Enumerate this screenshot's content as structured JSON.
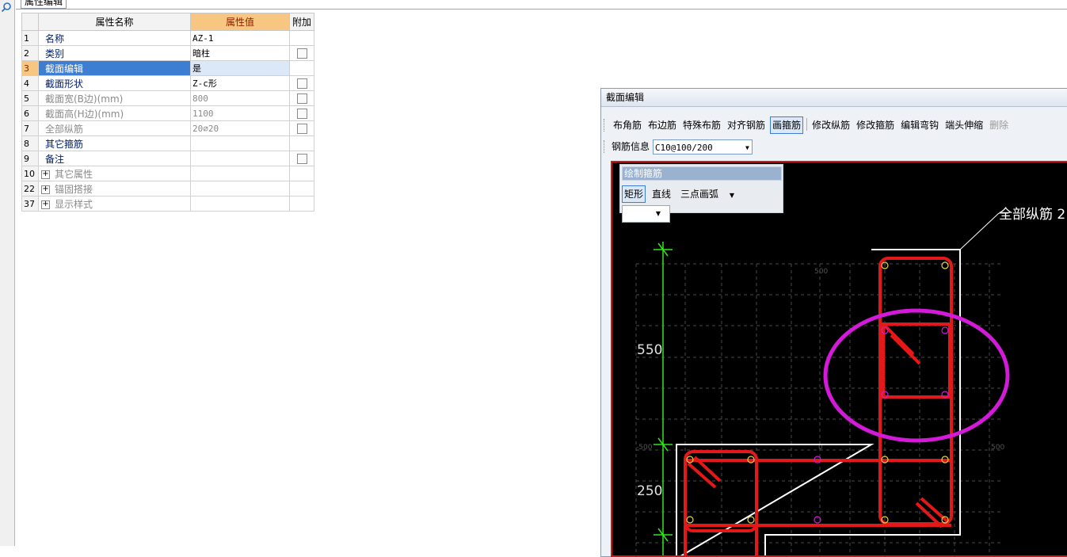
{
  "tab": {
    "label": "属性编辑"
  },
  "grid": {
    "headers": {
      "name": "属性名称",
      "value": "属性值",
      "extra": "附加"
    },
    "rows": [
      {
        "num": "1",
        "name": "名称",
        "value": "AZ-1"
      },
      {
        "num": "2",
        "name": "类别",
        "value": "暗柱"
      },
      {
        "num": "3",
        "name": "截面编辑",
        "value": "是"
      },
      {
        "num": "4",
        "name": "截面形状",
        "value": "Z-c形"
      },
      {
        "num": "5",
        "name": "截面宽(B边)(mm)",
        "value": "800"
      },
      {
        "num": "6",
        "name": "截面高(H边)(mm)",
        "value": "1100"
      },
      {
        "num": "7",
        "name": "全部纵筋",
        "value": "20⌀20"
      },
      {
        "num": "8",
        "name": "其它箍筋",
        "value": ""
      },
      {
        "num": "9",
        "name": "备注",
        "value": ""
      },
      {
        "num": "10",
        "name": "其它属性",
        "value": ""
      },
      {
        "num": "22",
        "name": "锚固搭接",
        "value": ""
      },
      {
        "num": "37",
        "name": "显示样式",
        "value": ""
      }
    ]
  },
  "section": {
    "title": "截面编辑",
    "toolbar": [
      "布角筋",
      "布边筋",
      "特殊布筋",
      "对齐钢筋",
      "画箍筋",
      "修改纵筋",
      "修改箍筋",
      "编辑弯钩",
      "端头伸缩",
      "删除"
    ],
    "info_label": "钢筋信息",
    "info_value": "C10@100/200",
    "draw": {
      "title": "绘制箍筋",
      "rect": "矩形",
      "line": "直线",
      "arc": "三点画弧"
    },
    "canvas": {
      "dim1": "550",
      "dim2": "250",
      "callout": "全部纵筋 2",
      "grid_500": "500",
      "grid_m500": "-500",
      "grid_0": "0",
      "grid_500r": "500"
    }
  },
  "colors": {
    "accent": "#f7c680",
    "selection": "#3e7ed2",
    "rebar": "#e31818",
    "highlight": "#d21ad8",
    "dimension": "#2ee81a"
  }
}
